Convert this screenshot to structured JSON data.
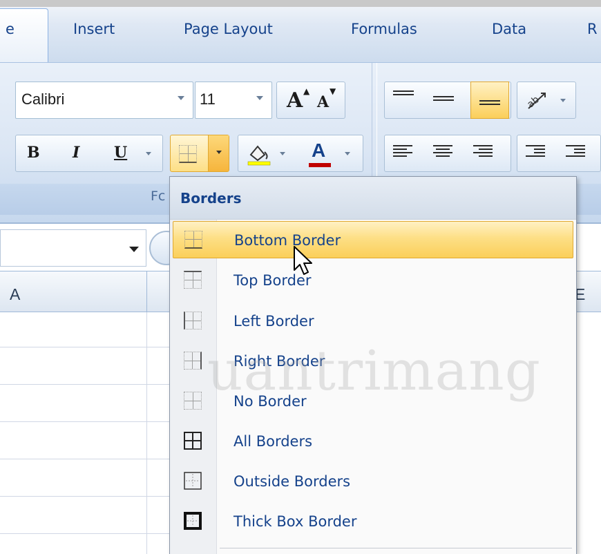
{
  "ribbon": {
    "tabs": [
      "e",
      "Insert",
      "Page Layout",
      "Formulas",
      "Data",
      "R"
    ],
    "font_name": "Calibri",
    "font_size": "11",
    "grow_font_label": "A",
    "shrink_font_label": "A",
    "bold_label": "B",
    "italic_label": "I",
    "underline_label": "U",
    "font_color_label": "A",
    "group_label_partial": "Fc"
  },
  "sheet": {
    "column_a_label": "A",
    "column_e_label_partial": "E"
  },
  "borders_menu": {
    "title": "Borders",
    "items": [
      {
        "label": "Bottom Border",
        "icon": "bottom-border-icon",
        "active": true
      },
      {
        "label": "Top Border",
        "icon": "top-border-icon"
      },
      {
        "label": "Left Border",
        "icon": "left-border-icon"
      },
      {
        "label": "Right Border",
        "icon": "right-border-icon"
      },
      {
        "label": "No Border",
        "icon": "no-border-icon"
      },
      {
        "label": "All Borders",
        "icon": "all-borders-icon"
      },
      {
        "label": "Outside Borders",
        "icon": "outside-borders-icon"
      },
      {
        "label": "Thick Box Border",
        "icon": "thick-box-border-icon"
      }
    ]
  },
  "watermark": "uantrimang",
  "colors": {
    "accent_text": "#15428b",
    "highlight": "#fddf86",
    "highlight_border": "#e0a830"
  }
}
